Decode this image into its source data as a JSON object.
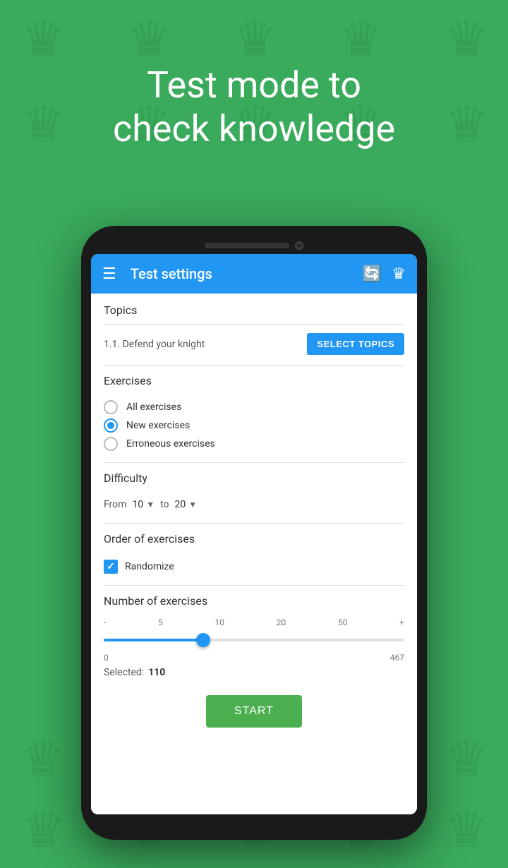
{
  "background": {
    "color": "#3aaa5c"
  },
  "hero": {
    "line1": "Test mode to",
    "line2": "check knowledge"
  },
  "phone": {
    "appbar": {
      "title": "Test settings",
      "icons": [
        "refresh-icon",
        "chess-icon"
      ]
    },
    "topics": {
      "section_title": "Topics",
      "topic_value": "1.1. Defend your knight",
      "button_label": "SELECT TOPICS"
    },
    "exercises": {
      "section_title": "Exercises",
      "options": [
        {
          "label": "All exercises",
          "selected": false
        },
        {
          "label": "New exercises",
          "selected": true
        },
        {
          "label": "Erroneous exercises",
          "selected": false
        }
      ]
    },
    "difficulty": {
      "section_title": "Difficulty",
      "from_label": "From",
      "from_value": "10",
      "to_label": "to",
      "to_value": "20"
    },
    "order": {
      "section_title": "Order of exercises",
      "randomize_label": "Randomize",
      "randomize_checked": true
    },
    "number": {
      "section_title": "Number of exercises",
      "tick_labels": [
        "-",
        "5",
        "10",
        "20",
        "50",
        "+"
      ],
      "range_min": "0",
      "range_max": "467",
      "slider_percent": 33,
      "selected_label": "Selected:",
      "selected_value": "110"
    },
    "start_button": "START"
  }
}
